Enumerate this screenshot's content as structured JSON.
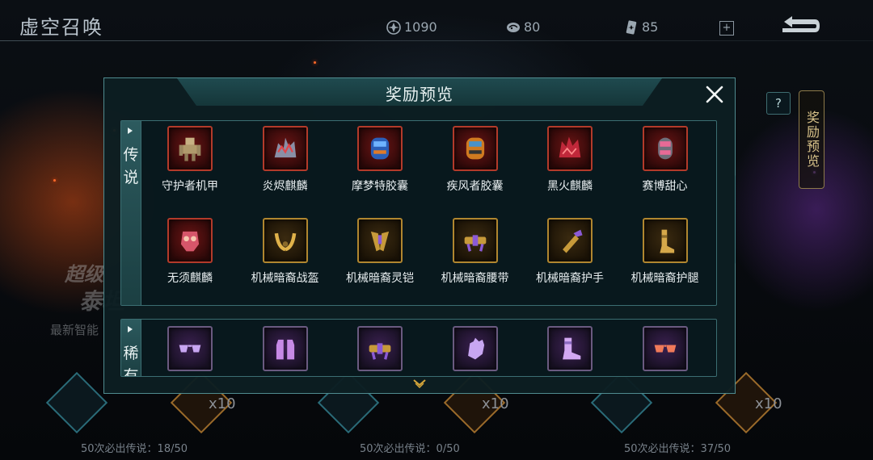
{
  "screen_title": "虚空召唤",
  "resources": [
    {
      "icon": "void-crystal-icon",
      "value": "1090"
    },
    {
      "icon": "fossil-icon",
      "value": "80"
    },
    {
      "icon": "summon-ticket-icon",
      "value": "85"
    }
  ],
  "side": {
    "help_label": "?",
    "preview_label": "奖励预览"
  },
  "modal": {
    "title": "奖励预览",
    "sections": [
      {
        "label": "传说",
        "rarity_color": "#b33a2a",
        "items": [
          {
            "name": "守护者机甲",
            "frame": "red",
            "icon": "guardian-mech-icon"
          },
          {
            "name": "炎烬麒麟",
            "frame": "red",
            "icon": "flame-qilin-icon"
          },
          {
            "name": "摩梦特胶囊",
            "frame": "red",
            "icon": "momunt-capsule-icon"
          },
          {
            "name": "疾风者胶囊",
            "frame": "red",
            "icon": "gale-capsule-icon"
          },
          {
            "name": "黑火麒麟",
            "frame": "red",
            "icon": "blackfire-qilin-icon"
          },
          {
            "name": "赛博甜心",
            "frame": "red",
            "icon": "cyber-sweetheart-icon"
          },
          {
            "name": "无须麒麟",
            "frame": "red",
            "icon": "beardless-qilin-icon"
          },
          {
            "name": "机械暗裔战盔",
            "frame": "gold",
            "icon": "helmet-icon"
          },
          {
            "name": "机械暗裔灵铠",
            "frame": "gold",
            "icon": "armor-icon"
          },
          {
            "name": "机械暗裔腰带",
            "frame": "gold",
            "icon": "belt-icon"
          },
          {
            "name": "机械暗裔护手",
            "frame": "gold",
            "icon": "gauntlet-icon"
          },
          {
            "name": "机械暗裔护腿",
            "frame": "gold",
            "icon": "leggings-icon"
          }
        ]
      },
      {
        "label": "稀有",
        "rarity_color": "#6a5a80",
        "items": [
          {
            "name": "",
            "frame": "purple",
            "icon": "glasses-icon"
          },
          {
            "name": "",
            "frame": "purple",
            "icon": "vest-icon"
          },
          {
            "name": "",
            "frame": "purple",
            "icon": "belt-icon"
          },
          {
            "name": "",
            "frame": "purple",
            "icon": "glove-icon"
          },
          {
            "name": "",
            "frame": "purple",
            "icon": "boots-icon"
          },
          {
            "name": "",
            "frame": "purple",
            "icon": "goggles-icon"
          }
        ]
      }
    ]
  },
  "background": {
    "banner_texts": [
      "超级",
      "泰坦",
      "最新智能"
    ],
    "pools": [
      {
        "multiplier": "x10",
        "guarantee": "50次必出传说：18/50"
      },
      {
        "multiplier": "x10",
        "guarantee": "50次必出传说：0/50"
      },
      {
        "multiplier": "x10",
        "guarantee": "50次必出传说：37/50"
      }
    ]
  }
}
